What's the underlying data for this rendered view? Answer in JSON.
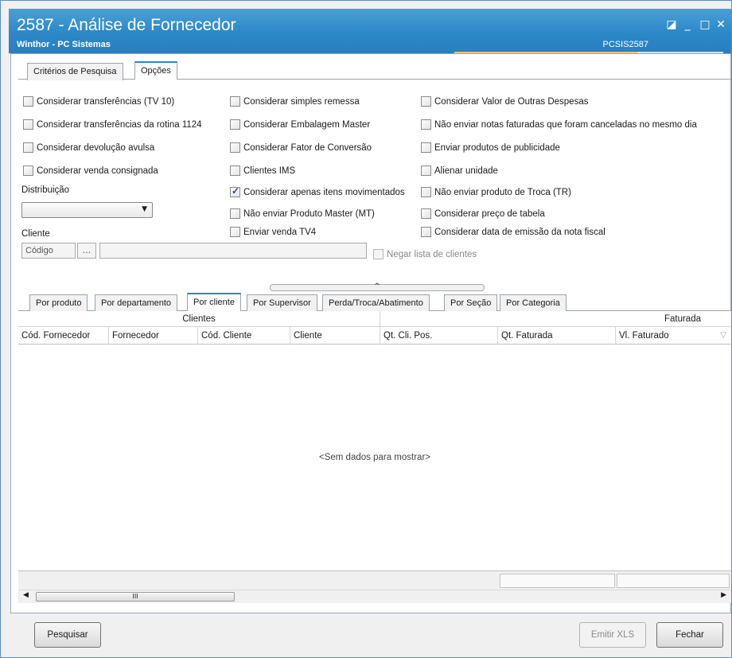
{
  "window": {
    "title": "2587 - Análise de Fornecedor",
    "subtitle": "Winthor - PC Sistemas",
    "code": "PCSIS2587",
    "controls": {
      "restore": "◪",
      "minimize": "_",
      "maximize": "□",
      "close": "✕"
    }
  },
  "top_tabs": [
    {
      "label": "Critérios de Pesquisa",
      "active": false
    },
    {
      "label": "Opções",
      "active": true
    }
  ],
  "options": {
    "col1": [
      {
        "label": "Considerar transferências (TV 10)",
        "checked": false
      },
      {
        "label": "Considerar transferências da rotina 1124",
        "checked": false
      },
      {
        "label": "Considerar devolução avulsa",
        "checked": false
      },
      {
        "label": "Considerar venda consignada",
        "checked": false
      }
    ],
    "col2": [
      {
        "label": "Considerar simples remessa",
        "checked": false
      },
      {
        "label": "Considerar Embalagem Master",
        "checked": false
      },
      {
        "label": "Considerar Fator de Conversão",
        "checked": false
      },
      {
        "label": "Clientes IMS",
        "checked": false
      },
      {
        "label": "Considerar apenas itens movimentados",
        "checked": true
      },
      {
        "label": "Não enviar Produto Master (MT)",
        "checked": false
      },
      {
        "label": "Enviar venda TV4",
        "checked": false
      }
    ],
    "col3": [
      {
        "label": "Considerar Valor de Outras Despesas",
        "checked": false
      },
      {
        "label": "Não enviar notas faturadas que foram canceladas no mesmo dia",
        "checked": false
      },
      {
        "label": "Enviar produtos de publicidade",
        "checked": false
      },
      {
        "label": "Alienar unidade",
        "checked": false
      },
      {
        "label": "Não enviar produto de Troca (TR)",
        "checked": false
      },
      {
        "label": "Considerar preço de tabela",
        "checked": false
      },
      {
        "label": "Considerar data de emissão da nota fiscal",
        "checked": false
      }
    ]
  },
  "distribuicao": {
    "label": "Distribuição",
    "value": ""
  },
  "cliente": {
    "label": "Cliente",
    "code_placeholder": "Código",
    "lookup": "...",
    "negar_label": "Negar lista de clientes"
  },
  "bottom_tabs": [
    {
      "label": "Por produto",
      "active": false
    },
    {
      "label": "Por departamento",
      "active": false
    },
    {
      "label": "Por cliente",
      "active": true
    },
    {
      "label": "Por Supervisor",
      "active": false
    },
    {
      "label": "Perda/Troca/Abatimento",
      "active": false
    },
    {
      "label": "Por Seção",
      "active": false
    },
    {
      "label": "Por Categoria",
      "active": false
    }
  ],
  "grid": {
    "bands": [
      "Clientes",
      "Faturada"
    ],
    "columns": [
      "Cód. Fornecedor",
      "Fornecedor",
      "Cód. Cliente",
      "Cliente",
      "Qt. Cli. Pos.",
      "Qt. Faturada",
      "Vl. Faturado"
    ],
    "empty_text": "<Sem dados para mostrar>"
  },
  "scroll": {
    "left": "◀",
    "right": "▶",
    "grip": "III"
  },
  "buttons": {
    "pesquisar": "Pesquisar",
    "emitir_xls": "Emitir XLS",
    "fechar": "Fechar"
  }
}
